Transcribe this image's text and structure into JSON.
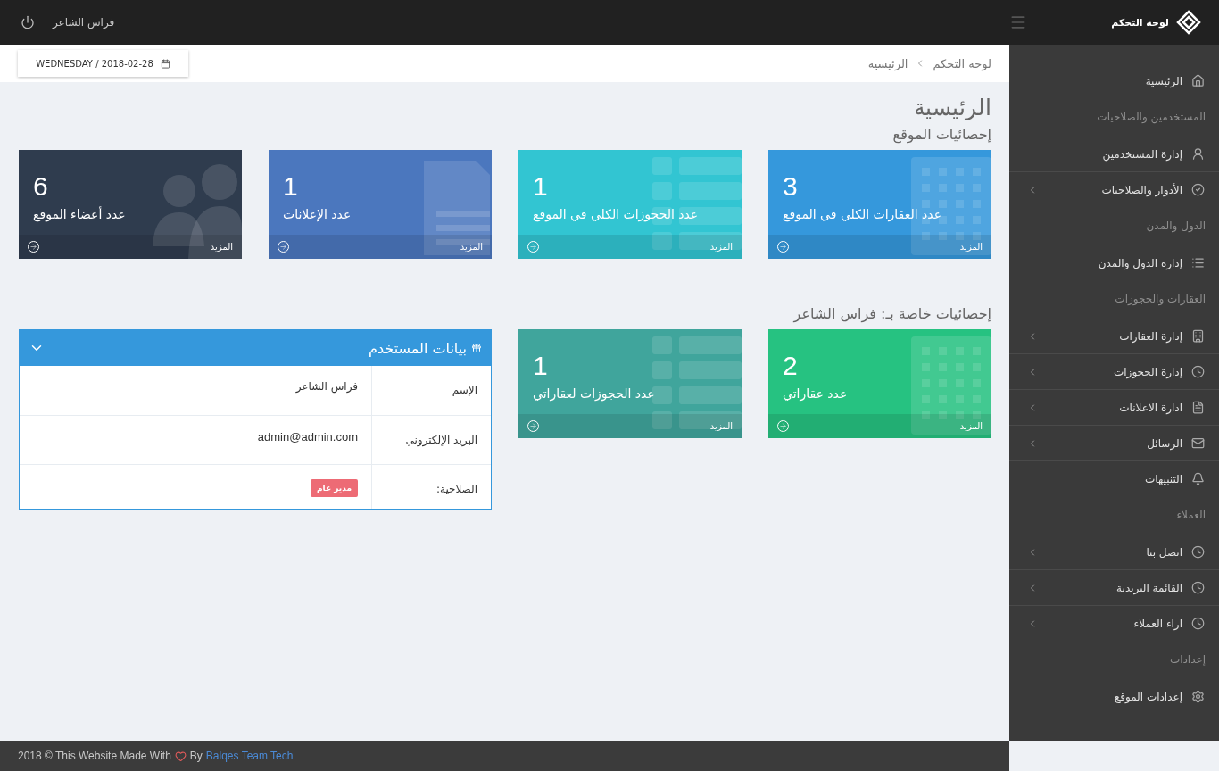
{
  "topbar": {
    "brand": "لوحة التحكم",
    "user": "فراس الشاعر"
  },
  "breadcrumb": [
    "لوحة التحكم",
    "الرئيسية"
  ],
  "date": "WEDNESDAY / 2018-02-28",
  "page_title": "الرئيسية",
  "site_stats": {
    "title": "إحصائيات الموقع",
    "cards": [
      {
        "value": "3",
        "label": "عدد العقارات الكلي في الموقع",
        "more": "المزيد",
        "color": "#3598dc"
      },
      {
        "value": "1",
        "label": "عدد الحجوزات الكلي في الموقع",
        "more": "المزيد",
        "color": "#32c5d2"
      },
      {
        "value": "1",
        "label": "عدد الإعلانات",
        "more": "المزيد",
        "color": "#4b77be"
      },
      {
        "value": "6",
        "label": "عدد أعضاء الموقع",
        "more": "المزيد",
        "color": "#2f3c4e"
      }
    ]
  },
  "user_stats": {
    "title": "إحصائيات خاصة بـ: فراس الشاعر",
    "cards": [
      {
        "value": "2",
        "label": "عدد عقاراتي",
        "more": "المزيد",
        "color": "#26c281"
      },
      {
        "value": "1",
        "label": "عدد الحجوزات لعقاراتي",
        "more": "المزيد",
        "color": "#40a59c"
      }
    ]
  },
  "user_panel": {
    "title": "بيانات المستخدم",
    "rows": [
      {
        "label": "الإسم",
        "value": "فراس الشاعر",
        "kind": "text"
      },
      {
        "label": "البريد الإلكتروني",
        "value": "admin@admin.com",
        "kind": "text"
      },
      {
        "label": "الصلاحية:",
        "value": "مدير عام",
        "kind": "badge",
        "color": "#ed6b75"
      }
    ]
  },
  "sidebar": {
    "items": [
      {
        "kind": "link",
        "label": "الرئيسية",
        "has_submenu": false
      },
      {
        "kind": "heading",
        "label": "المستخدمين والصلاحيات"
      },
      {
        "kind": "link",
        "label": "إدارة المستخدمين",
        "has_submenu": false
      },
      {
        "kind": "link",
        "label": "الأدوار والصلاحيات",
        "has_submenu": true
      },
      {
        "kind": "heading",
        "label": "الدول والمدن"
      },
      {
        "kind": "link",
        "label": "إدارة الدول والمدن",
        "has_submenu": false
      },
      {
        "kind": "heading",
        "label": "العقارات والحجوزات"
      },
      {
        "kind": "link",
        "label": "إدارة العقارات",
        "has_submenu": true
      },
      {
        "kind": "link",
        "label": "إدارة الحجوزات",
        "has_submenu": true
      },
      {
        "kind": "link",
        "label": "ادارة الاعلانات",
        "has_submenu": true
      },
      {
        "kind": "link",
        "label": "الرسائل",
        "has_submenu": true
      },
      {
        "kind": "link",
        "label": "التنبيهات",
        "has_submenu": false
      },
      {
        "kind": "heading",
        "label": "العملاء"
      },
      {
        "kind": "link",
        "label": "اتصل بنا",
        "has_submenu": true
      },
      {
        "kind": "link",
        "label": "القائمة البريدية",
        "has_submenu": true
      },
      {
        "kind": "link",
        "label": "اراء العملاء",
        "has_submenu": true
      },
      {
        "kind": "heading",
        "label": "إعدادات"
      },
      {
        "kind": "link",
        "label": "إعدادات الموقع",
        "has_submenu": false
      }
    ]
  },
  "footer": {
    "text": "2018 © This Website Made With",
    "by": "By",
    "link": "Balqes Team Tech"
  }
}
